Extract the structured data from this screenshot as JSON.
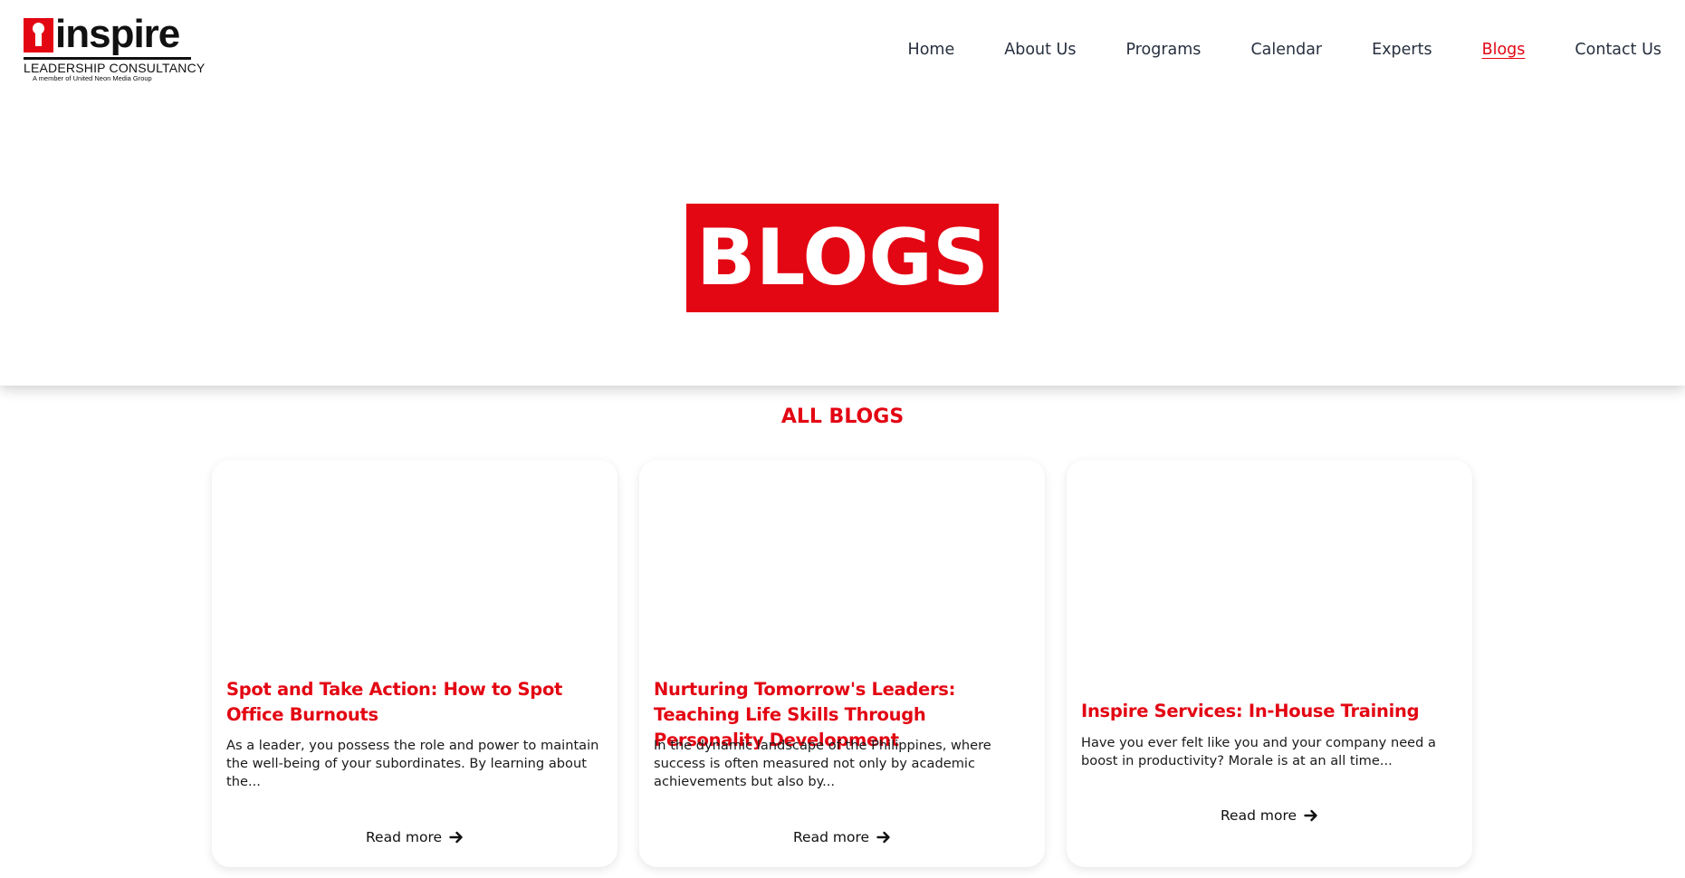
{
  "brand": {
    "name": "inspire",
    "subtitle": "LEADERSHIP CONSULTANCY",
    "tagline": "A member of United Neon Media Group",
    "accent_color": "#e30613"
  },
  "nav": {
    "items": [
      {
        "label": "Home",
        "active": false
      },
      {
        "label": "About Us",
        "active": false
      },
      {
        "label": "Programs",
        "active": false
      },
      {
        "label": "Calendar",
        "active": false
      },
      {
        "label": "Experts",
        "active": false
      },
      {
        "label": "Blogs",
        "active": true
      },
      {
        "label": "Contact Us",
        "active": false
      }
    ]
  },
  "hero": {
    "title": "BLOGS"
  },
  "section": {
    "title": "ALL BLOGS"
  },
  "posts": [
    {
      "title": "Spot and Take Action: How to Spot Office Burnouts",
      "excerpt": "As a leader, you possess the role and power to maintain the well-being of your subordinates. By learning about the...",
      "cta": "Read more",
      "cta_icon": "arrow-right-icon"
    },
    {
      "title": "Nurturing Tomorrow's Leaders: Teaching Life Skills Through Personality Development",
      "excerpt": "In the dynamic landscape of the Philippines, where success is often measured not only by academic achievements but also by...",
      "cta": "Read more",
      "cta_icon": "arrow-right-icon"
    },
    {
      "title": "Inspire Services: In-House Training",
      "excerpt": "Have you ever felt like you and your company need a boost in productivity? Morale is at an all time...",
      "cta": "Read more",
      "cta_icon": "arrow-right-icon"
    }
  ]
}
